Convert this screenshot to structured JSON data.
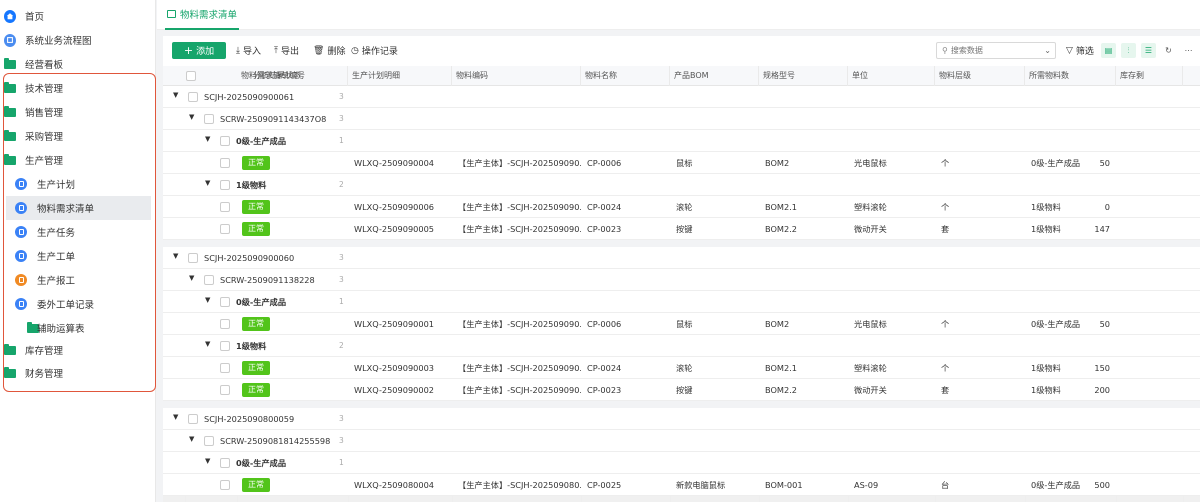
{
  "sidebar": {
    "items": [
      {
        "label": "首页",
        "icon": "home-icon"
      },
      {
        "label": "系统业务流程图",
        "icon": "flow-icon"
      },
      {
        "label": "经营看板",
        "icon": "folder-icon"
      },
      {
        "label": "技术管理",
        "icon": "folder-icon"
      },
      {
        "label": "销售管理",
        "icon": "folder-icon"
      },
      {
        "label": "采购管理",
        "icon": "folder-icon"
      },
      {
        "label": "生产管理",
        "icon": "folder-icon"
      },
      {
        "label": "生产计划",
        "icon": "document-icon"
      },
      {
        "label": "物料需求清单",
        "icon": "document-icon"
      },
      {
        "label": "生产任务",
        "icon": "document-icon"
      },
      {
        "label": "生产工单",
        "icon": "document-icon"
      },
      {
        "label": "生产报工",
        "icon": "document-icon"
      },
      {
        "label": "委外工单记录",
        "icon": "document-icon"
      },
      {
        "label": "辅助运算表",
        "icon": "folder-icon"
      },
      {
        "label": "库存管理",
        "icon": "folder-icon"
      },
      {
        "label": "财务管理",
        "icon": "folder-icon"
      }
    ]
  },
  "tab": {
    "label": "物料需求清单"
  },
  "toolbar": {
    "add": "添加",
    "import": "导入",
    "export": "导出",
    "delete": "删除",
    "log": "操作记录",
    "search_placeholder": "搜索数据",
    "filter": "筛选"
  },
  "columns": [
    "分析结果状态",
    "物料需求清单编号",
    "生产计划明细",
    "物料编码",
    "物料名称",
    "产品BOM",
    "规格型号",
    "单位",
    "物料层级",
    "所需物料数",
    "库存剩"
  ],
  "groups": [
    {
      "plan": "SCJH-2025090900061",
      "plan_count": "3",
      "task": "SCRW-2509091143437O8",
      "task_count": "3",
      "levels": [
        {
          "label": "0级-生产成品",
          "count": "1",
          "rows": [
            {
              "status": "正常",
              "code": "WLXQ-2509090004",
              "detail": "【生产主体】-SCJH-202509090...",
              "item": "CP-0006",
              "name": "鼠标",
              "bom": "BOM2",
              "spec": "光电鼠标",
              "unit": "个",
              "level": "0级-生产成品",
              "qty": "50"
            }
          ]
        },
        {
          "label": "1级物料",
          "count": "2",
          "rows": [
            {
              "status": "正常",
              "code": "WLXQ-2509090006",
              "detail": "【生产主体】-SCJH-202509090...",
              "item": "CP-0024",
              "name": "滚轮",
              "bom": "BOM2.1",
              "spec": "塑料滚轮",
              "unit": "个",
              "level": "1级物料",
              "qty": "0"
            },
            {
              "status": "正常",
              "code": "WLXQ-2509090005",
              "detail": "【生产主体】-SCJH-202509090...",
              "item": "CP-0023",
              "name": "按键",
              "bom": "BOM2.2",
              "spec": "微动开关",
              "unit": "套",
              "level": "1级物料",
              "qty": "147"
            }
          ]
        }
      ]
    },
    {
      "plan": "SCJH-2025090900060",
      "plan_count": "3",
      "task": "SCRW-2509091138228",
      "task_count": "3",
      "levels": [
        {
          "label": "0级-生产成品",
          "count": "1",
          "rows": [
            {
              "status": "正常",
              "code": "WLXQ-2509090001",
              "detail": "【生产主体】-SCJH-202509090...",
              "item": "CP-0006",
              "name": "鼠标",
              "bom": "BOM2",
              "spec": "光电鼠标",
              "unit": "个",
              "level": "0级-生产成品",
              "qty": "50"
            }
          ]
        },
        {
          "label": "1级物料",
          "count": "2",
          "rows": [
            {
              "status": "正常",
              "code": "WLXQ-2509090003",
              "detail": "【生产主体】-SCJH-202509090...",
              "item": "CP-0024",
              "name": "滚轮",
              "bom": "BOM2.1",
              "spec": "塑料滚轮",
              "unit": "个",
              "level": "1级物料",
              "qty": "150"
            },
            {
              "status": "正常",
              "code": "WLXQ-2509090002",
              "detail": "【生产主体】-SCJH-202509090...",
              "item": "CP-0023",
              "name": "按键",
              "bom": "BOM2.2",
              "spec": "微动开关",
              "unit": "套",
              "level": "1级物料",
              "qty": "200"
            }
          ]
        }
      ]
    },
    {
      "plan": "SCJH-2025090800059",
      "plan_count": "3",
      "task": "SCRW-2509081814255598",
      "task_count": "3",
      "levels": [
        {
          "label": "0级-生产成品",
          "count": "1",
          "rows": [
            {
              "status": "正常",
              "code": "WLXQ-2509080004",
              "detail": "【生产主体】-SCJH-202509080...",
              "item": "CP-0025",
              "name": "新款电脑鼠标",
              "bom": "BOM-001",
              "spec": "AS-09",
              "unit": "台",
              "level": "0级-生产成品",
              "qty": "500"
            }
          ]
        }
      ]
    }
  ],
  "colors": {
    "brand": "#16a56b",
    "status_ok": "#52c41a",
    "highlight_border": "#e0563b"
  }
}
